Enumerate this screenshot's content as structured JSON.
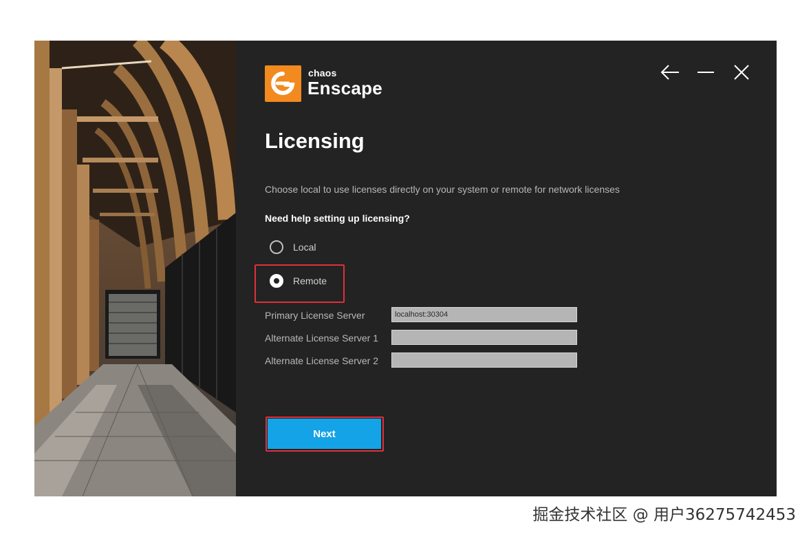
{
  "brand": {
    "company": "chaos",
    "product": "Enscape",
    "accent": "#f28a1f"
  },
  "window_controls": {
    "back_icon": "arrow-left-icon",
    "minimize_icon": "minimize-icon",
    "close_icon": "close-icon"
  },
  "page": {
    "title": "Licensing",
    "description": "Choose local to use licenses directly on your system or remote for network licenses",
    "help_link": "Need help setting up licensing?"
  },
  "license_mode": {
    "options": [
      {
        "label": "Local",
        "selected": false
      },
      {
        "label": "Remote",
        "selected": true
      }
    ]
  },
  "servers": {
    "primary": {
      "label": "Primary License Server",
      "value": "localhost:30304"
    },
    "alternate1": {
      "label": "Alternate License Server 1",
      "value": ""
    },
    "alternate2": {
      "label": "Alternate License Server 2",
      "value": ""
    }
  },
  "actions": {
    "next_label": "Next",
    "next_color": "#14a3e6"
  },
  "highlight_color": "#e0303a",
  "watermark": "掘金技术社区 @ 用户36275742453"
}
